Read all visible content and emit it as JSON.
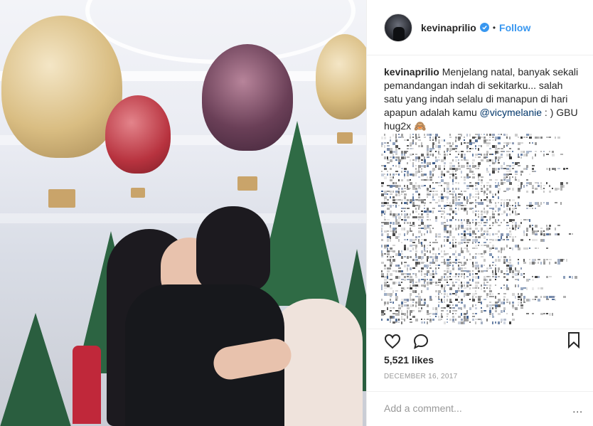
{
  "post": {
    "photo": {
      "alt": "",
      "icon": "photo"
    },
    "header": {
      "username": "kevinaprilio",
      "verified": true,
      "separator": "•",
      "follow_label": "Follow"
    },
    "caption": {
      "username": "kevinaprilio",
      "text_before_mention": "Menjelang natal, banyak sekali pemandangan indah di sekitarku... salah satu yang indah selalu di manapun di hari apapun adalah kamu ",
      "mention": "@vicymelanie",
      "text_after_mention": " : ) GBU hug2x 🙈"
    },
    "actions": {
      "like_icon": "heart-icon",
      "comment_icon": "comment-icon",
      "save_icon": "bookmark-icon"
    },
    "likes": "5,521 likes",
    "date": "DECEMBER 16, 2017",
    "comment_box": {
      "placeholder": "Add a comment...",
      "more_label": "..."
    },
    "colors": {
      "accent": "#3897f0",
      "text": "#262626",
      "muted": "#999999",
      "border": "#efefef"
    }
  }
}
